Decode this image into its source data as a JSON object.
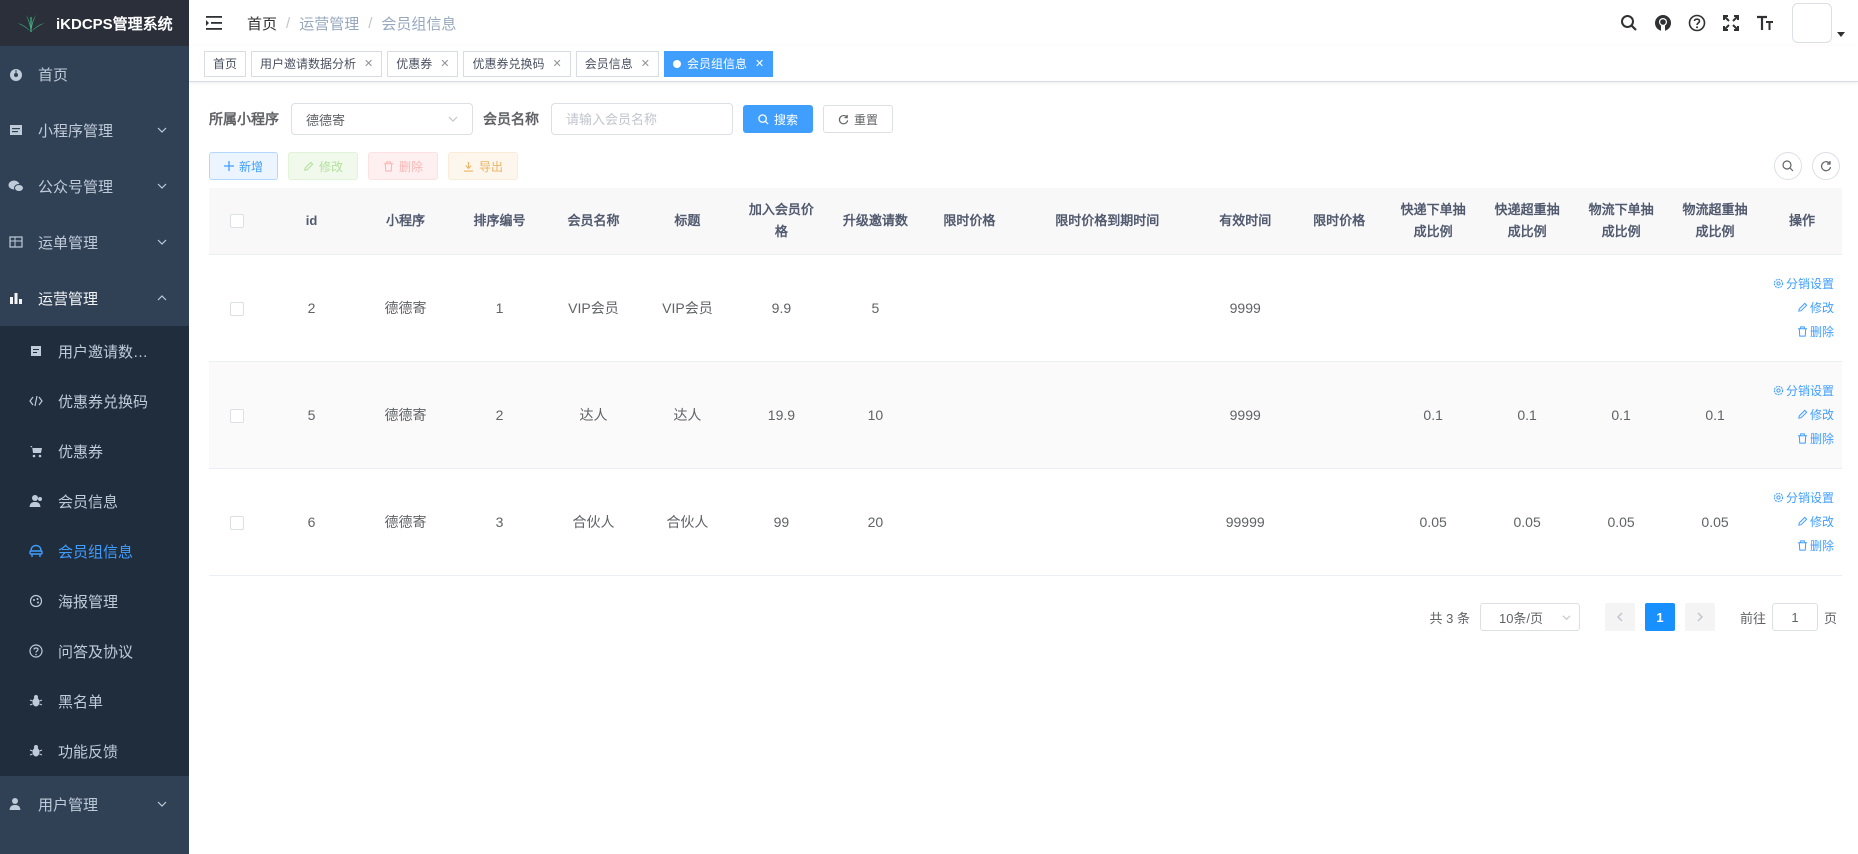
{
  "app": {
    "title": "iKDCPS管理系统"
  },
  "sidebar": {
    "items": [
      {
        "label": "首页",
        "icon": "dashboard-icon"
      },
      {
        "label": "小程序管理",
        "icon": "miniprogram-icon"
      },
      {
        "label": "公众号管理",
        "icon": "wechat-icon"
      },
      {
        "label": "运单管理",
        "icon": "table-icon"
      },
      {
        "label": "运营管理",
        "icon": "chart-icon"
      }
    ],
    "sub_items": [
      {
        "label": "用户邀请数…",
        "icon": "report-icon"
      },
      {
        "label": "优惠券兑换码",
        "icon": "code-icon"
      },
      {
        "label": "优惠券",
        "icon": "cart-icon"
      },
      {
        "label": "会员信息",
        "icon": "people-icon"
      },
      {
        "label": "会员组信息",
        "icon": "peoples-icon"
      },
      {
        "label": "海报管理",
        "icon": "poster-icon"
      },
      {
        "label": "问答及协议",
        "icon": "question-icon"
      },
      {
        "label": "黑名单",
        "icon": "bug-icon"
      },
      {
        "label": "功能反馈",
        "icon": "bug-icon"
      }
    ],
    "bottom_item": {
      "label": "用户管理",
      "icon": "user-icon"
    }
  },
  "breadcrumb": [
    "首页",
    "运营管理",
    "会员组信息"
  ],
  "tags": [
    {
      "label": "首页",
      "closable": false
    },
    {
      "label": "用户邀请数据分析",
      "closable": true
    },
    {
      "label": "优惠券",
      "closable": true
    },
    {
      "label": "优惠券兑换码",
      "closable": true
    },
    {
      "label": "会员信息",
      "closable": true
    },
    {
      "label": "会员组信息",
      "closable": true,
      "active": true
    }
  ],
  "search": {
    "program_label": "所属小程序",
    "program_value": "德德寄",
    "name_label": "会员名称",
    "name_placeholder": "请输入会员名称",
    "search_btn": "搜索",
    "reset_btn": "重置"
  },
  "toolbar": {
    "add": "新增",
    "edit": "修改",
    "delete": "删除",
    "export": "导出"
  },
  "table": {
    "headers": {
      "id": "id",
      "program": "小程序",
      "sort": "排序编号",
      "name": "会员名称",
      "title": "标题",
      "join_price_1": "加入会员价",
      "join_price_2": "格",
      "upgrade": "升级邀请数",
      "limit_price": "限时价格",
      "limit_expire": "限时价格到期时间",
      "valid": "有效时间",
      "limit_price2": "限时价格",
      "express_order_1": "快递下单抽",
      "express_order_2": "成比例",
      "express_over_1": "快递超重抽",
      "express_over_2": "成比例",
      "logistics_order_1": "物流下单抽",
      "logistics_order_2": "成比例",
      "logistics_over_1": "物流超重抽",
      "logistics_over_2": "成比例",
      "ops": "操作"
    },
    "rows": [
      {
        "id": "2",
        "program": "德德寄",
        "sort": "1",
        "name": "VIP会员",
        "title": "VIP会员",
        "join_price": "9.9",
        "upgrade": "5",
        "limit_price": "",
        "limit_expire": "",
        "valid": "9999",
        "limit_price2": "",
        "express_order": "",
        "express_over": "",
        "logistics_order": "",
        "logistics_over": ""
      },
      {
        "id": "5",
        "program": "德德寄",
        "sort": "2",
        "name": "达人",
        "title": "达人",
        "join_price": "19.9",
        "upgrade": "10",
        "limit_price": "",
        "limit_expire": "",
        "valid": "9999",
        "limit_price2": "",
        "express_order": "0.1",
        "express_over": "0.1",
        "logistics_order": "0.1",
        "logistics_over": "0.1"
      },
      {
        "id": "6",
        "program": "德德寄",
        "sort": "3",
        "name": "合伙人",
        "title": "合伙人",
        "join_price": "99",
        "upgrade": "20",
        "limit_price": "",
        "limit_expire": "",
        "valid": "99999",
        "limit_price2": "",
        "express_order": "0.05",
        "express_over": "0.05",
        "logistics_order": "0.05",
        "logistics_over": "0.05"
      }
    ],
    "ops": {
      "dist": "分销设置",
      "edit": "修改",
      "delete": "删除"
    }
  },
  "pagination": {
    "total": "共 3 条",
    "page_size": "10条/页",
    "current": "1",
    "goto_label": "前往",
    "goto_value": "1",
    "page_suffix": "页"
  },
  "colors": {
    "primary": "#409eff",
    "sidebar_bg": "#304156",
    "sidebar_sub_bg": "#1f2d3d"
  }
}
